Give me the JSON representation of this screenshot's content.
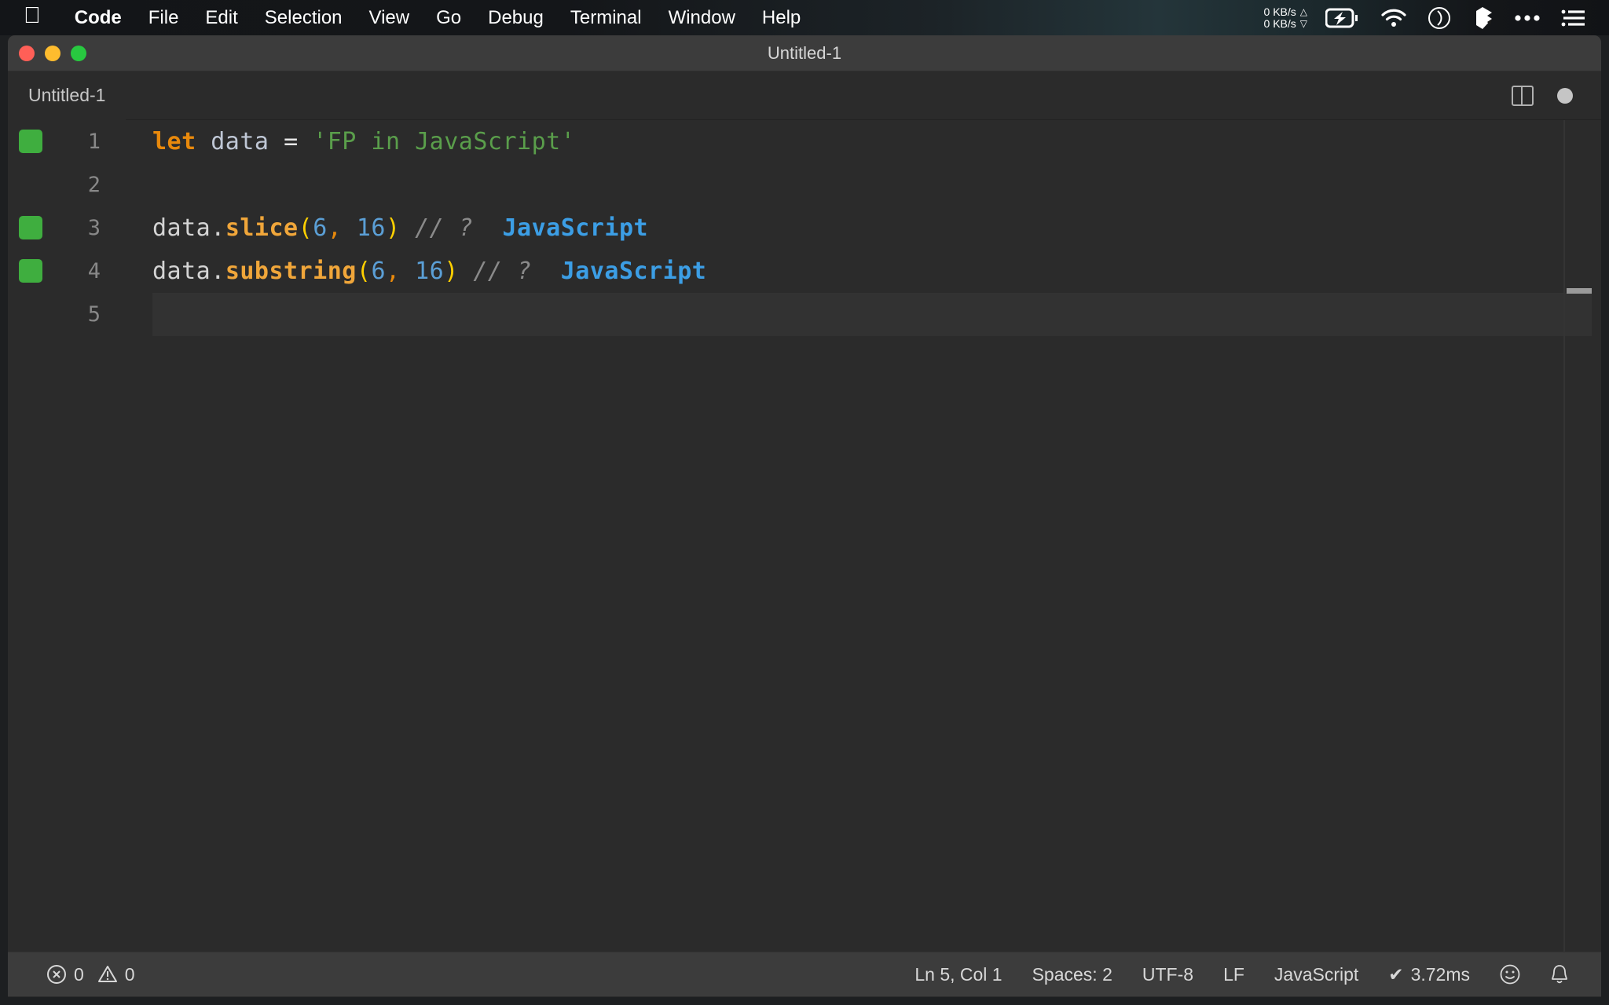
{
  "menubar": {
    "apple_logo": "apple-logo",
    "items": [
      {
        "label": "Code",
        "bold": true
      },
      {
        "label": "File"
      },
      {
        "label": "Edit"
      },
      {
        "label": "Selection"
      },
      {
        "label": "View"
      },
      {
        "label": "Go"
      },
      {
        "label": "Debug"
      },
      {
        "label": "Terminal"
      },
      {
        "label": "Window"
      },
      {
        "label": "Help"
      }
    ],
    "network": {
      "up": "0 KB/s",
      "down": "0 KB/s",
      "up_arrow": "△",
      "down_arrow": "▽"
    },
    "icons": [
      "battery-charging-icon",
      "wifi-icon",
      "clock-icon",
      "dropbox-icon",
      "ellipsis-icon",
      "list-icon"
    ]
  },
  "window": {
    "title": "Untitled-1",
    "traffic_lights": [
      "close-button",
      "minimize-button",
      "maximize-button"
    ]
  },
  "tabbar": {
    "tabs": [
      {
        "label": "Untitled-1",
        "active": true,
        "dirty": true
      }
    ],
    "split_editor_label": "split-editor",
    "dirty_indicator": "unsaved-changes"
  },
  "editor": {
    "language": "JavaScript",
    "lines": [
      {
        "number": "1",
        "marker": true,
        "current": false,
        "tokens": [
          {
            "t": "let",
            "c": "kw"
          },
          {
            "t": " ",
            "c": "plain"
          },
          {
            "t": "data",
            "c": "var"
          },
          {
            "t": " ",
            "c": "plain"
          },
          {
            "t": "=",
            "c": "op"
          },
          {
            "t": " ",
            "c": "plain"
          },
          {
            "t": "'FP in JavaScript'",
            "c": "str"
          }
        ]
      },
      {
        "number": "2",
        "marker": false,
        "current": false,
        "tokens": []
      },
      {
        "number": "3",
        "marker": true,
        "current": false,
        "tokens": [
          {
            "t": "data",
            "c": "plain"
          },
          {
            "t": ".",
            "c": "plain"
          },
          {
            "t": "slice",
            "c": "fn"
          },
          {
            "t": "(",
            "c": "paren"
          },
          {
            "t": "6",
            "c": "num"
          },
          {
            "t": ",",
            "c": "comma"
          },
          {
            "t": " ",
            "c": "plain"
          },
          {
            "t": "16",
            "c": "num"
          },
          {
            "t": ")",
            "c": "paren"
          },
          {
            "t": " ",
            "c": "plain"
          },
          {
            "t": "// ?",
            "c": "comment"
          },
          {
            "t": "  ",
            "c": "plain"
          },
          {
            "t": "JavaScript",
            "c": "result"
          }
        ]
      },
      {
        "number": "4",
        "marker": true,
        "current": false,
        "tokens": [
          {
            "t": "data",
            "c": "plain"
          },
          {
            "t": ".",
            "c": "plain"
          },
          {
            "t": "substring",
            "c": "fn"
          },
          {
            "t": "(",
            "c": "paren"
          },
          {
            "t": "6",
            "c": "num"
          },
          {
            "t": ",",
            "c": "comma"
          },
          {
            "t": " ",
            "c": "plain"
          },
          {
            "t": "16",
            "c": "num"
          },
          {
            "t": ")",
            "c": "paren"
          },
          {
            "t": " ",
            "c": "plain"
          },
          {
            "t": "// ?",
            "c": "comment"
          },
          {
            "t": "  ",
            "c": "plain"
          },
          {
            "t": "JavaScript",
            "c": "result"
          }
        ]
      },
      {
        "number": "5",
        "marker": false,
        "current": true,
        "tokens": []
      }
    ]
  },
  "statusbar": {
    "errors": "0",
    "warnings": "0",
    "cursor": "Ln 5, Col 1",
    "indentation": "Spaces: 2",
    "encoding": "UTF-8",
    "eol": "LF",
    "language": "JavaScript",
    "runtime": "3.72ms",
    "runtime_check": "✔",
    "feedback_icon": "smiley-icon",
    "notifications_icon": "bell-icon"
  },
  "colors": {
    "editor_bg": "#2b2b2b",
    "chrome_bg": "#3c3c3c",
    "marker_green": "#3fae3f",
    "result_blue": "#3c9ee5",
    "keyword_orange": "#e8890c",
    "string_green": "#5a9e4b",
    "paren_yellow": "#ffd000",
    "number_blue": "#5b9fd6"
  }
}
